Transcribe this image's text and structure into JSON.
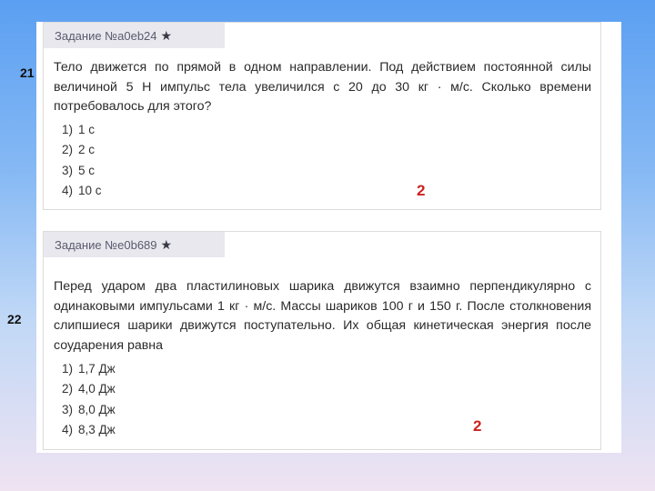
{
  "tasks": [
    {
      "side_number": "21",
      "header": "Задание №a0eb24",
      "star": "★",
      "question": "Тело движется по прямой в одном направлении. Под действием постоянной силы величиной 5 Н импульс тела увеличился с 20 до 30 кг · м/с. Сколько времени потребовалось для этого?",
      "options": [
        {
          "num": "1)",
          "text": "1 с"
        },
        {
          "num": "2)",
          "text": "2 с"
        },
        {
          "num": "3)",
          "text": "5 с"
        },
        {
          "num": "4)",
          "text": "10 с"
        }
      ],
      "answer": "2"
    },
    {
      "side_number": "22",
      "header": "Задание №e0b689",
      "star": "★",
      "question": "Перед ударом два пластилиновых шарика движутся взаимно перпендикулярно с одинаковыми импульсами 1 кг · м/с. Массы шариков 100 г и 150 г. После столкновения слипшиеся шарики движутся поступательно. Их общая кинетическая энергия после соударения равна",
      "options": [
        {
          "num": "1)",
          "text": "1,7 Дж"
        },
        {
          "num": "2)",
          "text": "4,0 Дж"
        },
        {
          "num": "3)",
          "text": "8,0 Дж"
        },
        {
          "num": "4)",
          "text": "8,3 Дж"
        }
      ],
      "answer": "2"
    }
  ],
  "colors": {
    "answer": "#cc2222",
    "tag_background": "#e9e8ee",
    "tag_text": "#5a5a6e"
  }
}
